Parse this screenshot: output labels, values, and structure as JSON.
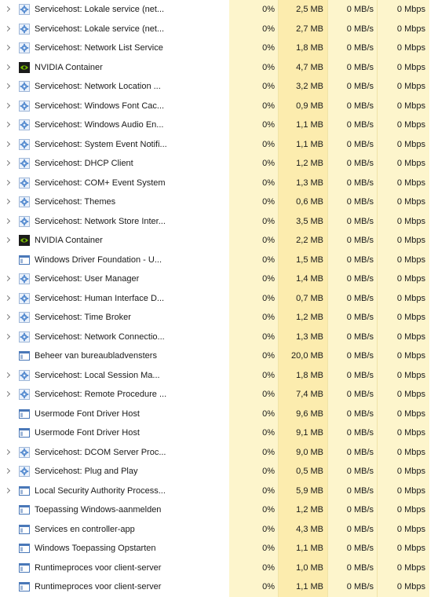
{
  "processes": [
    {
      "name": "Servicehost: Lokale service (net...",
      "icon": "gear-icon",
      "expand": true,
      "cpu": "0%",
      "memory": "2,5 MB",
      "disk": "0 MB/s",
      "network": "0 Mbps"
    },
    {
      "name": "Servicehost: Lokale service (net...",
      "icon": "gear-icon",
      "expand": true,
      "cpu": "0%",
      "memory": "2,7 MB",
      "disk": "0 MB/s",
      "network": "0 Mbps"
    },
    {
      "name": "Servicehost: Network List Service",
      "icon": "gear-icon",
      "expand": true,
      "cpu": "0%",
      "memory": "1,8 MB",
      "disk": "0 MB/s",
      "network": "0 Mbps"
    },
    {
      "name": "NVIDIA Container",
      "icon": "nvidia-icon",
      "expand": true,
      "cpu": "0%",
      "memory": "4,7 MB",
      "disk": "0 MB/s",
      "network": "0 Mbps"
    },
    {
      "name": "Servicehost: Network Location ...",
      "icon": "gear-icon",
      "expand": true,
      "cpu": "0%",
      "memory": "3,2 MB",
      "disk": "0 MB/s",
      "network": "0 Mbps"
    },
    {
      "name": "Servicehost: Windows Font Cac...",
      "icon": "gear-icon",
      "expand": true,
      "cpu": "0%",
      "memory": "0,9 MB",
      "disk": "0 MB/s",
      "network": "0 Mbps"
    },
    {
      "name": "Servicehost: Windows Audio En...",
      "icon": "gear-icon",
      "expand": true,
      "cpu": "0%",
      "memory": "1,1 MB",
      "disk": "0 MB/s",
      "network": "0 Mbps"
    },
    {
      "name": "Servicehost: System Event Notifi...",
      "icon": "gear-icon",
      "expand": true,
      "cpu": "0%",
      "memory": "1,1 MB",
      "disk": "0 MB/s",
      "network": "0 Mbps"
    },
    {
      "name": "Servicehost: DHCP Client",
      "icon": "gear-icon",
      "expand": true,
      "cpu": "0%",
      "memory": "1,2 MB",
      "disk": "0 MB/s",
      "network": "0 Mbps"
    },
    {
      "name": "Servicehost: COM+ Event System",
      "icon": "gear-icon",
      "expand": true,
      "cpu": "0%",
      "memory": "1,3 MB",
      "disk": "0 MB/s",
      "network": "0 Mbps"
    },
    {
      "name": "Servicehost: Themes",
      "icon": "gear-icon",
      "expand": true,
      "cpu": "0%",
      "memory": "0,6 MB",
      "disk": "0 MB/s",
      "network": "0 Mbps"
    },
    {
      "name": "Servicehost: Network Store Inter...",
      "icon": "gear-icon",
      "expand": true,
      "cpu": "0%",
      "memory": "3,5 MB",
      "disk": "0 MB/s",
      "network": "0 Mbps"
    },
    {
      "name": "NVIDIA Container",
      "icon": "nvidia-icon",
      "expand": true,
      "cpu": "0%",
      "memory": "2,2 MB",
      "disk": "0 MB/s",
      "network": "0 Mbps"
    },
    {
      "name": "Windows Driver Foundation - U...",
      "icon": "window-icon",
      "expand": false,
      "cpu": "0%",
      "memory": "1,5 MB",
      "disk": "0 MB/s",
      "network": "0 Mbps"
    },
    {
      "name": "Servicehost: User Manager",
      "icon": "gear-icon",
      "expand": true,
      "cpu": "0%",
      "memory": "1,4 MB",
      "disk": "0 MB/s",
      "network": "0 Mbps"
    },
    {
      "name": "Servicehost: Human Interface D...",
      "icon": "gear-icon",
      "expand": true,
      "cpu": "0%",
      "memory": "0,7 MB",
      "disk": "0 MB/s",
      "network": "0 Mbps"
    },
    {
      "name": "Servicehost: Time Broker",
      "icon": "gear-icon",
      "expand": true,
      "cpu": "0%",
      "memory": "1,2 MB",
      "disk": "0 MB/s",
      "network": "0 Mbps"
    },
    {
      "name": "Servicehost: Network Connectio...",
      "icon": "gear-icon",
      "expand": true,
      "cpu": "0%",
      "memory": "1,3 MB",
      "disk": "0 MB/s",
      "network": "0 Mbps"
    },
    {
      "name": "Beheer van bureaubladvensters",
      "icon": "window-icon",
      "expand": false,
      "cpu": "0%",
      "memory": "20,0 MB",
      "disk": "0 MB/s",
      "network": "0 Mbps"
    },
    {
      "name": "Servicehost: Local Session Ma...",
      "icon": "gear-icon",
      "expand": true,
      "cpu": "0%",
      "memory": "1,8 MB",
      "disk": "0 MB/s",
      "network": "0 Mbps"
    },
    {
      "name": "Servicehost: Remote Procedure ...",
      "icon": "gear-icon",
      "expand": true,
      "cpu": "0%",
      "memory": "7,4 MB",
      "disk": "0 MB/s",
      "network": "0 Mbps"
    },
    {
      "name": "Usermode Font Driver Host",
      "icon": "window-icon",
      "expand": false,
      "cpu": "0%",
      "memory": "9,6 MB",
      "disk": "0 MB/s",
      "network": "0 Mbps"
    },
    {
      "name": "Usermode Font Driver Host",
      "icon": "window-icon",
      "expand": false,
      "cpu": "0%",
      "memory": "9,1 MB",
      "disk": "0 MB/s",
      "network": "0 Mbps"
    },
    {
      "name": "Servicehost: DCOM Server Proc...",
      "icon": "gear-icon",
      "expand": true,
      "cpu": "0%",
      "memory": "9,0 MB",
      "disk": "0 MB/s",
      "network": "0 Mbps"
    },
    {
      "name": "Servicehost: Plug and Play",
      "icon": "gear-icon",
      "expand": true,
      "cpu": "0%",
      "memory": "0,5 MB",
      "disk": "0 MB/s",
      "network": "0 Mbps"
    },
    {
      "name": "Local Security Authority Process...",
      "icon": "window-icon",
      "expand": true,
      "cpu": "0%",
      "memory": "5,9 MB",
      "disk": "0 MB/s",
      "network": "0 Mbps"
    },
    {
      "name": "Toepassing Windows-aanmelden",
      "icon": "window-icon",
      "expand": false,
      "cpu": "0%",
      "memory": "1,2 MB",
      "disk": "0 MB/s",
      "network": "0 Mbps"
    },
    {
      "name": "Services en controller-app",
      "icon": "window-icon",
      "expand": false,
      "cpu": "0%",
      "memory": "4,3 MB",
      "disk": "0 MB/s",
      "network": "0 Mbps"
    },
    {
      "name": "Windows Toepassing Opstarten",
      "icon": "window-icon",
      "expand": false,
      "cpu": "0%",
      "memory": "1,1 MB",
      "disk": "0 MB/s",
      "network": "0 Mbps"
    },
    {
      "name": "Runtimeproces voor client-server",
      "icon": "window-icon",
      "expand": false,
      "cpu": "0%",
      "memory": "1,0 MB",
      "disk": "0 MB/s",
      "network": "0 Mbps"
    },
    {
      "name": "Runtimeproces voor client-server",
      "icon": "window-icon",
      "expand": false,
      "cpu": "0%",
      "memory": "1,1 MB",
      "disk": "0 MB/s",
      "network": "0 Mbps"
    }
  ],
  "colors": {
    "cpu_bg": "#fdf5cc",
    "memory_bg": "#fcecae",
    "disk_bg": "#fdf5cc",
    "network_bg": "#fdf5cc",
    "nvidia_green": "#76b900",
    "gear_blue": "#5b8fd1"
  }
}
